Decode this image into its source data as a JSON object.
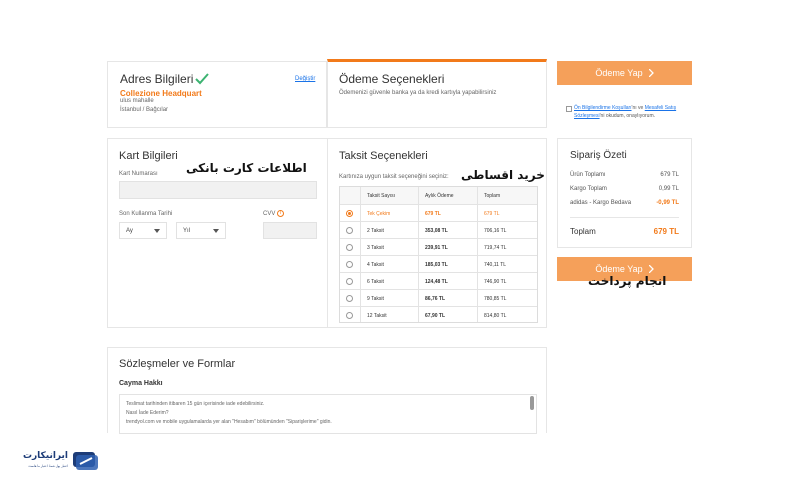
{
  "address": {
    "title": "Adres Bilgileri",
    "edit_label": "Değiştir",
    "name": "Collezione Headquart",
    "line1": "ulus mahalle",
    "line2": "İstanbul / Bağcılar"
  },
  "payment_options": {
    "title": "Ödeme Seçenekleri",
    "subtitle": "Ödemenizi güvenle banka ya da kredi kartıyla yapabilirsiniz"
  },
  "card_info": {
    "title": "Kart Bilgileri",
    "number_label": "Kart Numarası",
    "expiry_label": "Son Kullanma Tarihi",
    "month_placeholder": "Ay",
    "year_placeholder": "Yıl",
    "cvv_label": "CVV",
    "annotation": "اطلاعات کارت بانکی"
  },
  "installments": {
    "title": "Taksit Seçenekleri",
    "subtitle": "Kartınıza uygun taksit seçeneğini seçiniz:",
    "annotation": "خرید اقساطی",
    "headers": [
      "Taksit Sayısı",
      "Aylık Ödeme",
      "Toplam"
    ],
    "rows": [
      {
        "count": "Tek Çekim",
        "monthly": "679 TL",
        "total": "679 TL",
        "selected": true
      },
      {
        "count": "2 Taksit",
        "monthly": "353,08 TL",
        "total": "706,16 TL",
        "selected": false
      },
      {
        "count": "3 Taksit",
        "monthly": "239,91 TL",
        "total": "719,74 TL",
        "selected": false
      },
      {
        "count": "4 Taksit",
        "monthly": "185,03 TL",
        "total": "740,11 TL",
        "selected": false
      },
      {
        "count": "6 Taksit",
        "monthly": "124,48 TL",
        "total": "746,90 TL",
        "selected": false
      },
      {
        "count": "9 Taksit",
        "monthly": "86,76 TL",
        "total": "780,85 TL",
        "selected": false
      },
      {
        "count": "12 Taksit",
        "monthly": "67,90 TL",
        "total": "814,80 TL",
        "selected": false
      }
    ]
  },
  "agreements": {
    "title": "Sözleşmeler ve Formlar",
    "subtitle": "Cayma Hakkı",
    "lines": [
      "Teslimat tarihinden itibaren 15 gün içerisinde iade edebilirsiniz.",
      "Nasıl İade Ederim?",
      "trendyol.com ve mobile uygulamalarda yer alan \"Hesabım\" bölümünden \"Siparişlerime\" gidin."
    ]
  },
  "sidebar": {
    "pay_button": "Ödeme Yap",
    "terms_link1": "Ön Bilgilendirme Koşulları",
    "terms_mid": "'nı ve",
    "terms_link2": "Mesafeli Satış Sözleşmesi",
    "terms_end": "'ni okudum, onaylıyorum.",
    "summary_title": "Sipariş Özeti",
    "summary": [
      {
        "label": "Ürün Toplamı",
        "value": "679 TL"
      },
      {
        "label": "Kargo Toplam",
        "value": "0,99 TL"
      },
      {
        "label": "adidas - Kargo Bedava",
        "value": "-0,99 TL"
      }
    ],
    "total_label": "Toplam",
    "total_value": "679 TL",
    "pay_button_bottom": "Ödeme Yap",
    "annotation": "انجام پرداخت"
  },
  "logo": {
    "name": "ایرانیکارت",
    "tagline": "اعتبار پول شما، اعتبار ما هاست"
  },
  "colors": {
    "accent": "#f27a1a",
    "button": "#f5a05a",
    "check": "#3cb371",
    "link": "#1a73e8"
  }
}
